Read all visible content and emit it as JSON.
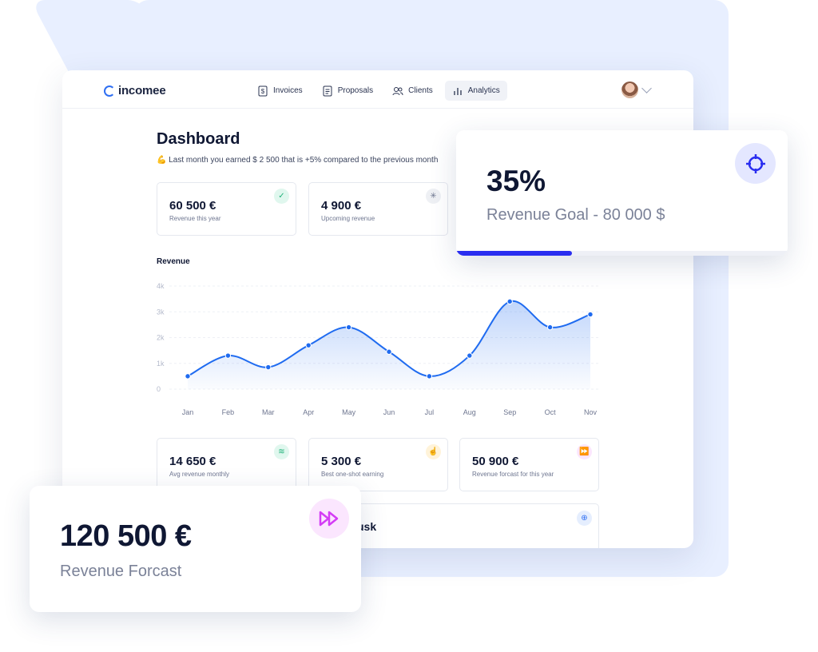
{
  "brand": {
    "name": "incomee"
  },
  "nav": [
    {
      "label": "Invoices",
      "icon": "dollar-doc-icon"
    },
    {
      "label": "Proposals",
      "icon": "doc-lines-icon"
    },
    {
      "label": "Clients",
      "icon": "users-icon"
    },
    {
      "label": "Analytics",
      "icon": "bar-chart-icon",
      "active": true
    }
  ],
  "page": {
    "title": "Dashboard",
    "subtitle_emoji": "💪",
    "subtitle": "Last month you earned $ 2 500 that is +5% compared to the previous month"
  },
  "stats_top": [
    {
      "value": "60 500 €",
      "label": "Revenue this year",
      "icon": "check-circle-icon"
    },
    {
      "value": "4 900 €",
      "label": "Upcoming revenue",
      "icon": "loader-icon"
    }
  ],
  "stats_bottom": [
    {
      "value": "14 650 €",
      "label": "Avg revenue monthly",
      "icon": "waves-icon"
    },
    {
      "value": "5 300 €",
      "label": "Best one-shot earning",
      "icon": "hand-pointer-icon"
    },
    {
      "value": "50 900 €",
      "label": "Revenue forcast for this year",
      "icon": "fast-forward-icon"
    }
  ],
  "team_card": {
    "title_fragment": "usk",
    "icon": "add-user-icon"
  },
  "chart_data": {
    "type": "area",
    "title": "Revenue",
    "categories": [
      "Jan",
      "Feb",
      "Mar",
      "Apr",
      "May",
      "Jun",
      "Jul",
      "Aug",
      "Sep",
      "Oct",
      "Nov"
    ],
    "values": [
      500,
      1300,
      850,
      1700,
      2400,
      1450,
      500,
      1300,
      3400,
      2400,
      2900
    ],
    "y_ticks": [
      "0",
      "1k",
      "2k",
      "3k",
      "4k"
    ],
    "ylim": [
      0,
      4000
    ],
    "grid": true,
    "color": "#1f6bf0"
  },
  "goal_card": {
    "percent": "35%",
    "label": "Revenue Goal - 80 000 $",
    "progress": 0.35,
    "icon": "target-icon",
    "color": "#2a2ef0"
  },
  "forecast_card": {
    "value": "120 500 €",
    "label": "Revenue Forcast",
    "icon": "fast-forward-icon",
    "color": "#d43cf5"
  }
}
